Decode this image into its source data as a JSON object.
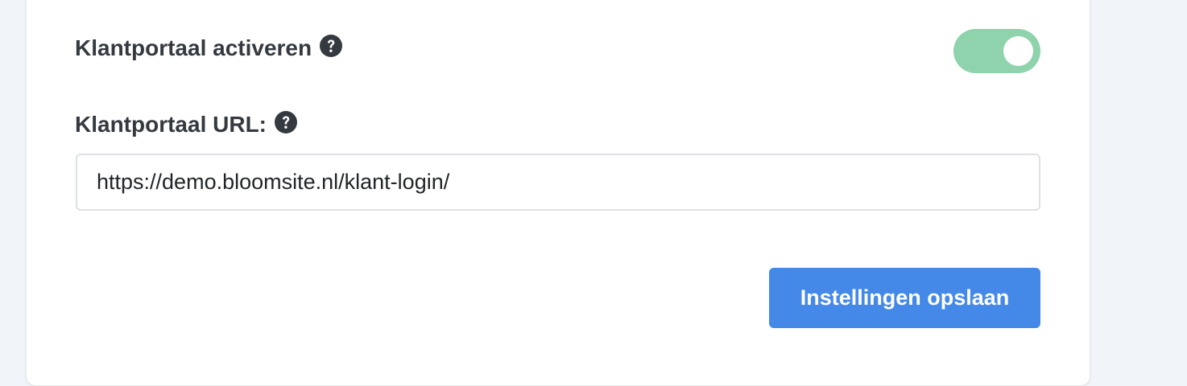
{
  "settings": {
    "portal_toggle": {
      "label": "Klantportaal activeren",
      "enabled": true,
      "color_on": "#8ed3ab"
    },
    "portal_url": {
      "label": "Klantportaal URL:",
      "value": "https://demo.bloomsite.nl/klant-login/"
    },
    "save_button": {
      "label": "Instellingen opslaan",
      "color": "#4589e8"
    },
    "icons": {
      "help": "question-circle-icon"
    }
  }
}
